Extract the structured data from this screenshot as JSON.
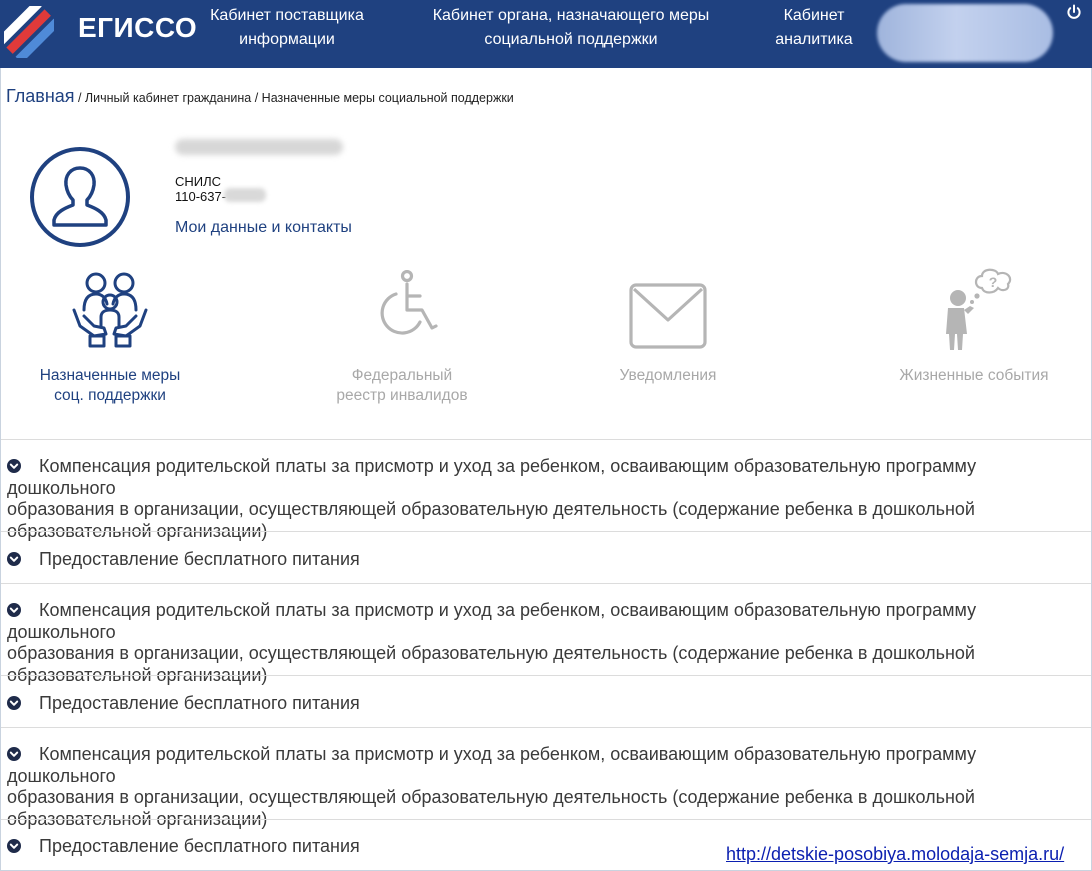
{
  "header": {
    "brand": "ЕГИССО",
    "nav": [
      {
        "line1": "Кабинет поставщика",
        "line2": "информации"
      },
      {
        "line1": "Кабинет органа, назначающего меры",
        "line2": "социальной поддержки"
      },
      {
        "line1": "Кабинет",
        "line2": "аналитика"
      }
    ],
    "icons": {
      "power": "power-icon",
      "logo": "egisso-logo"
    }
  },
  "breadcrumb": {
    "home": "Главная",
    "rest": " / Личный кабинет гражданина / Назначенные меры социальной поддержки"
  },
  "profile": {
    "snils_label": "СНИЛС",
    "snils_value": "110-637-",
    "contacts_link": "Мои данные и контакты"
  },
  "tiles": [
    {
      "line1": "Назначенные меры",
      "line2": "соц. поддержки",
      "icon": "family-icon",
      "active": true
    },
    {
      "line1": "Федеральный",
      "line2": "реестр инвалидов",
      "icon": "wheelchair-icon",
      "active": false
    },
    {
      "line1": "Уведомления",
      "line2": "",
      "icon": "envelope-icon",
      "active": false
    },
    {
      "line1": "Жизненные события",
      "line2": "",
      "icon": "thinking-person-icon",
      "active": false
    }
  ],
  "accordion": [
    {
      "line1": "Компенсация родительской платы за присмотр и уход за ребенком, осваивающим образовательную программу дошкольного",
      "line2": "образования в организации, осуществляющей образовательную деятельность (содержание ребенка в дошкольной",
      "line3": "образовательной организации)"
    },
    {
      "line1": "Предоставление бесплатного питания"
    },
    {
      "line1": "Компенсация родительской платы за присмотр и уход за ребенком, осваивающим образовательную программу дошкольного",
      "line2": "образования в организации, осуществляющей образовательную деятельность (содержание ребенка в дошкольной",
      "line3": "образовательной организации)"
    },
    {
      "line1": "Предоставление бесплатного питания"
    },
    {
      "line1": "Компенсация родительской платы за присмотр и уход за ребенком, осваивающим образовательную программу дошкольного",
      "line2": "образования в организации, осуществляющей образовательную деятельность (содержание ребенка в дошкольной",
      "line3": "образовательной организации)"
    },
    {
      "line1": "Предоставление бесплатного питания"
    }
  ],
  "watermark": "http://detskie-posobiya.molodaja-semja.ru/",
  "colors": {
    "header": "#1f4180",
    "accent": "#1f4180",
    "muted": "#a8a8a8",
    "logo_red": "#e03a3a"
  }
}
